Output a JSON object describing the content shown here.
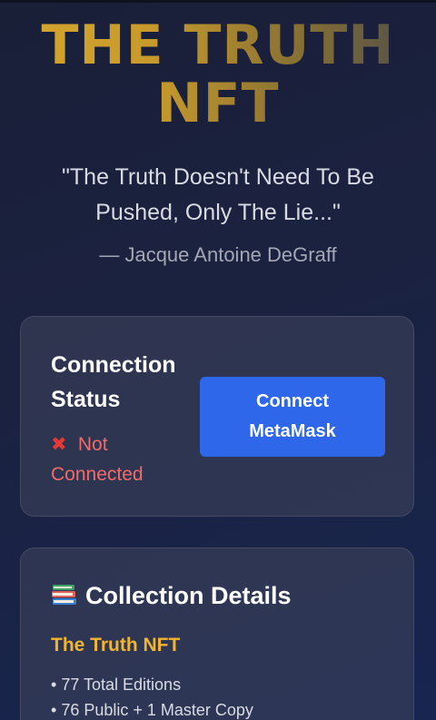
{
  "hero": {
    "title_line1": "THE TRUTH",
    "title_line2": "NFT",
    "quote": "\"The Truth Doesn't Need To Be Pushed, Only The Lie...\"",
    "author": "— Jacque Antoine DeGraff"
  },
  "connection": {
    "heading": "Connection Status",
    "status_icon": "x-mark-icon",
    "status_text": "Not Connected",
    "button_label": "Connect MetaMask",
    "status_color": "#f26b6b",
    "button_color": "#2f67ea"
  },
  "collection": {
    "heading_icon": "books-icon",
    "heading": "Collection Details",
    "name": "The Truth NFT",
    "details": [
      "77 Total Editions",
      "76 Public + 1 Master Copy"
    ],
    "accent_color": "#f2b531"
  }
}
